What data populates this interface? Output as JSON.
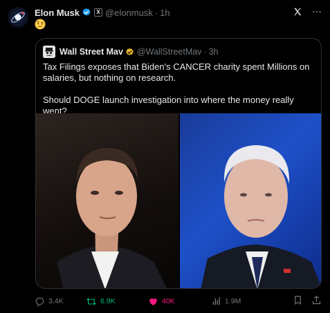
{
  "post": {
    "author_name": "Elon Musk",
    "author_handle": "@elonmusk",
    "time": "1h",
    "separator": "·",
    "emoji": "🤨"
  },
  "quote": {
    "author_name": "Wall Street Mav",
    "author_handle": "@WallStreetMav",
    "time": "3h",
    "separator": "·",
    "text_1": "Tax Filings exposes that Biden's CANCER charity spent Millions on salaries, but nothing on research.",
    "text_2": "Should DOGE launch investigation into where the money really went?"
  },
  "actions": {
    "replies": "3.4K",
    "reposts": "6.9K",
    "likes": "40K",
    "views": "1.9M"
  },
  "badges": {
    "x_badge": "X"
  },
  "colors": {
    "verified_blue": "#1d9bf0",
    "verified_gold": "#e8b62f",
    "repost_green": "#00ba7c",
    "like_pink": "#f91880",
    "muted": "#71767b"
  },
  "icons": [
    "verified-badge-icon",
    "grok-icon",
    "more-icon",
    "reply-icon",
    "repost-icon",
    "like-icon",
    "views-icon",
    "bookmark-icon",
    "share-icon"
  ]
}
